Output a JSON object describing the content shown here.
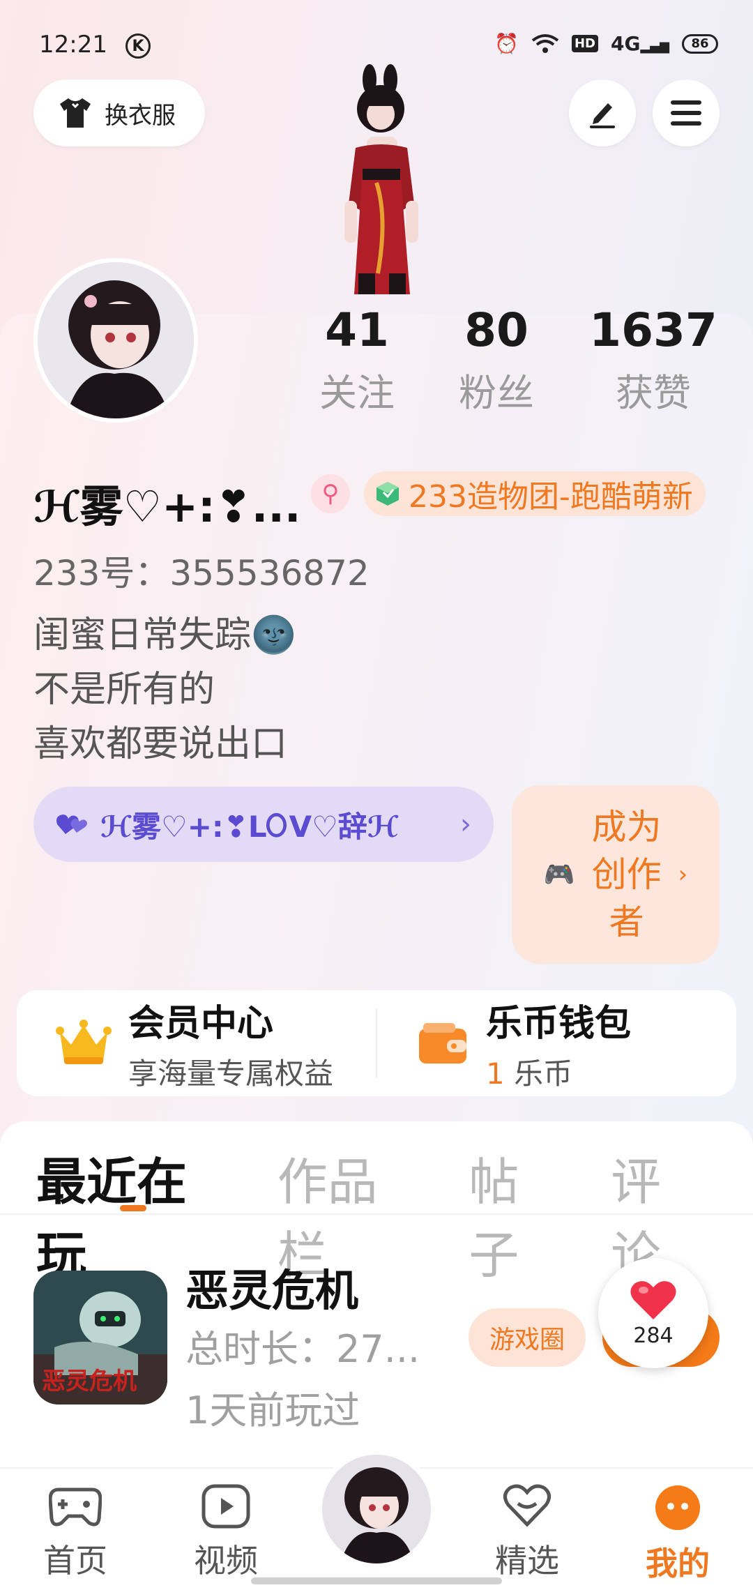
{
  "status_bar": {
    "time": "12:21",
    "k_badge": "K",
    "network": "4G",
    "hd": "HD",
    "battery": "86"
  },
  "top": {
    "dress_label": "换衣服"
  },
  "stats": [
    {
      "value": "41",
      "label": "关注"
    },
    {
      "value": "80",
      "label": "粉丝"
    },
    {
      "value": "1637",
      "label": "获赞"
    }
  ],
  "profile": {
    "name": "ℋ雾♡+:❣...",
    "gender_symbol": "⚲",
    "group": "233造物团-跑酷萌新",
    "uid": "233号：355536872",
    "bio": [
      "闺蜜日常失踪🌚",
      "不是所有的",
      "喜欢都要说出口"
    ],
    "tag": "ℋ雾♡+:❣L𐊒V♡辞ℋ"
  },
  "creator": {
    "label": "成为创作者"
  },
  "cards": {
    "vip_title": "会员中心",
    "vip_sub": "享海量专属权益",
    "wallet_title": "乐币钱包",
    "wallet_amount": "1",
    "wallet_unit": "乐币"
  },
  "tabs": [
    "最近在玩",
    "作品栏",
    "帖子",
    "评论"
  ],
  "game": {
    "name": "恶灵危机",
    "duration": "总时长：27...",
    "last_played": "1天前玩过",
    "circle_label": "游戏圈",
    "likes": "284"
  },
  "nav": [
    {
      "label": "首页"
    },
    {
      "label": "视频"
    },
    {
      "label": "精选"
    },
    {
      "label": "我的"
    }
  ],
  "colors": {
    "accent": "#f07820",
    "tag_purple": "#5a4bd0",
    "like_red": "#f0324a"
  }
}
